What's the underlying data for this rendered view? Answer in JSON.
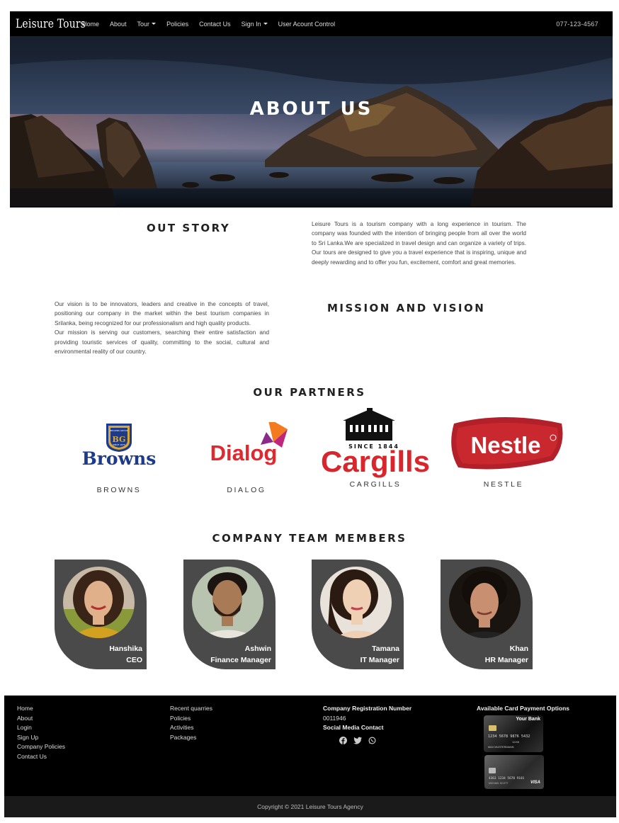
{
  "nav": {
    "brand": "Leisure Tours",
    "items": [
      "Home",
      "About",
      "Tour",
      "Policies",
      "Contact Us",
      "Sign In",
      "User Acount Control"
    ],
    "phone": "077-123-4567"
  },
  "hero": {
    "title": "ABOUT US"
  },
  "story": {
    "title": "OUT STORY",
    "text": "Leisure Tours is a tourism company with a long experience in tourism. The company was founded with the intention of bringing people from all over the world to Sri Lanka.We are specialized in travel design and can organize a variety of trips. Our tours are designed to give you a travel experience that is inspiring, unique and deeply rewarding and to offer you fun, excitement, comfort and great memories."
  },
  "mission": {
    "title": "MISSION AND VISION",
    "vision": "Our vision is to be innovators, leaders and creative in the concepts of travel, positioning our company in the market within the best tourism companies in Srilanka, being recognized for our professionalism and high quality products.",
    "mission": "Our mission is serving our customers, searching their entire satisfaction and providing touristic services of quality, committing to the social, cultural and environmental reality of our country."
  },
  "partners": {
    "title": "OUR PARTNERS",
    "items": [
      {
        "name": "BROWNS",
        "logo": "Browns",
        "badge": "BG",
        "badge_top": "BROWNS GROUP",
        "badge_bot": "SINCE 1875"
      },
      {
        "name": "DIALOG",
        "logo": "Dialog"
      },
      {
        "name": "CARGILLS",
        "logo": "Cargills",
        "since": "SINCE 1844"
      },
      {
        "name": "NESTLE",
        "logo": "Nestle"
      }
    ]
  },
  "team": {
    "title": "COMPANY TEAM MEMBERS",
    "members": [
      {
        "name": "Hanshika",
        "role": "CEO"
      },
      {
        "name": "Ashwin",
        "role": "Finance Manager"
      },
      {
        "name": "Tamana",
        "role": "IT Manager"
      },
      {
        "name": "Khan",
        "role": "HR Manager"
      }
    ]
  },
  "footer": {
    "links1": [
      "Home",
      "About",
      "Login",
      "Sign Up",
      "Company Policies",
      "Contact Us"
    ],
    "links2": [
      "Recent quarries",
      "Policies",
      "Activities",
      "Packages"
    ],
    "reg_title": "Company Registration Number",
    "reg_number": "0011946",
    "social_title": "Social Media Contact",
    "social_icons": [
      "facebook-icon",
      "twitter-icon",
      "whatsapp-icon"
    ],
    "card_title": "Available Card Payment Options",
    "card1": {
      "bank": "Your Bank",
      "number": "1234 5678 9876 5432",
      "holder": "MAX MUSTERMANN",
      "expiry": "12/45"
    },
    "card2": {
      "number": "4363 1234 5678 9101",
      "holder": "MICHAEL SCOTT",
      "brand": "VISA"
    },
    "copyright": "Copyright © 2021 Leisure Tours Agency"
  },
  "colors": {
    "navbar": "#000000",
    "card": "#4a4a4a",
    "footer": "#000000",
    "copyright_bar": "#1a1a1a"
  }
}
